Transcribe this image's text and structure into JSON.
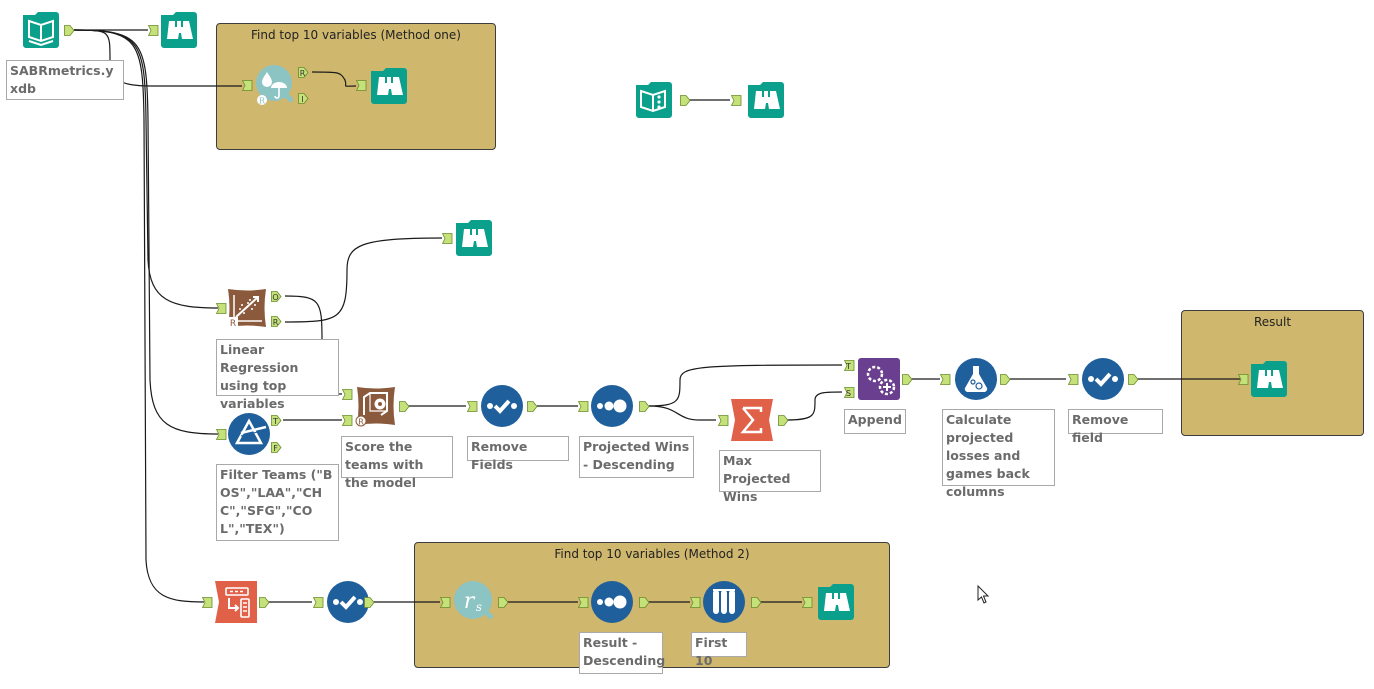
{
  "app": "Alteryx Designer workflow canvas",
  "colors": {
    "container_fill": "#cfb76e",
    "browse_teal": "#0aa08c",
    "blue_tool": "#1f5f9c",
    "brown_tool": "#8b5a3c",
    "orange_tool": "#e06048",
    "purple_tool": "#6b3f8f",
    "research_teal": "#8cc3c3",
    "anchor_green": "#c5e17a"
  },
  "containers": [
    {
      "id": "c1",
      "title": "Find top 10 variables (Method one)"
    },
    {
      "id": "c2",
      "title": "Find top 10 variables (Method 2)"
    },
    {
      "id": "c3",
      "title": "Result"
    }
  ],
  "tools": [
    {
      "id": "input",
      "icon": "input-data-icon",
      "label": "SABRmetrics.yxdb"
    },
    {
      "id": "browse1",
      "icon": "browse-icon",
      "label": ""
    },
    {
      "id": "forest",
      "icon": "forest-model-icon",
      "label": "",
      "anchors_out": [
        "R",
        "I"
      ]
    },
    {
      "id": "browse2",
      "icon": "browse-icon",
      "label": ""
    },
    {
      "id": "textinput",
      "icon": "text-input-icon",
      "label": ""
    },
    {
      "id": "browse3",
      "icon": "browse-icon",
      "label": ""
    },
    {
      "id": "browse4",
      "icon": "browse-icon",
      "label": ""
    },
    {
      "id": "linreg",
      "icon": "linear-regression-icon",
      "label": "Linear Regression using top variables",
      "anchors_out": [
        "O",
        "R"
      ]
    },
    {
      "id": "filter",
      "icon": "filter-icon",
      "label": "Filter Teams (\"BOS\",\"LAA\",\"CHC\",\"SFG\",\"COL\",\"TEX\")",
      "anchors_out": [
        "T",
        "F"
      ]
    },
    {
      "id": "score",
      "icon": "score-icon",
      "label": "Score the teams with the model"
    },
    {
      "id": "select1",
      "icon": "select-icon",
      "label": "Remove Fields"
    },
    {
      "id": "sort1",
      "icon": "sort-icon",
      "label": "Projected Wins - Descending"
    },
    {
      "id": "summarize",
      "icon": "summarize-icon",
      "label": "Max Projected Wins"
    },
    {
      "id": "append",
      "icon": "append-fields-icon",
      "label": "Append",
      "anchors_in": [
        "T",
        "S"
      ]
    },
    {
      "id": "formula",
      "icon": "formula-icon",
      "label": "Calculate projected losses and games back columns"
    },
    {
      "id": "select2",
      "icon": "select-icon",
      "label": "Remove field"
    },
    {
      "id": "browse5",
      "icon": "browse-icon",
      "label": ""
    },
    {
      "id": "transpose",
      "icon": "transpose-icon",
      "label": ""
    },
    {
      "id": "select3",
      "icon": "select-icon",
      "label": ""
    },
    {
      "id": "spearman",
      "icon": "spearman-correlation-icon",
      "label": ""
    },
    {
      "id": "sort2",
      "icon": "sort-icon",
      "label": "Result - Descending"
    },
    {
      "id": "sample",
      "icon": "sample-icon",
      "label": "First 10"
    },
    {
      "id": "browse6",
      "icon": "browse-icon",
      "label": ""
    }
  ],
  "labels": {
    "input": "SABRmetrics.yxdb",
    "linreg": "Linear Regression using top variables",
    "filter": "Filter Teams (\"BOS\",\"LAA\",\"CHC\",\"SFG\",\"COL\",\"TEX\")",
    "score": "Score the teams with the model",
    "select1": "Remove Fields",
    "sort1": "Projected Wins - Descending",
    "summarize": "Max Projected Wins",
    "append": "Append",
    "formula": "Calculate projected losses and games back columns",
    "select2": "Remove field",
    "sort2": "Result - Descending",
    "sample": "First 10"
  },
  "anchor_letters": {
    "R": "R",
    "I": "I",
    "O": "O",
    "T": "T",
    "F": "F",
    "S": "S"
  }
}
